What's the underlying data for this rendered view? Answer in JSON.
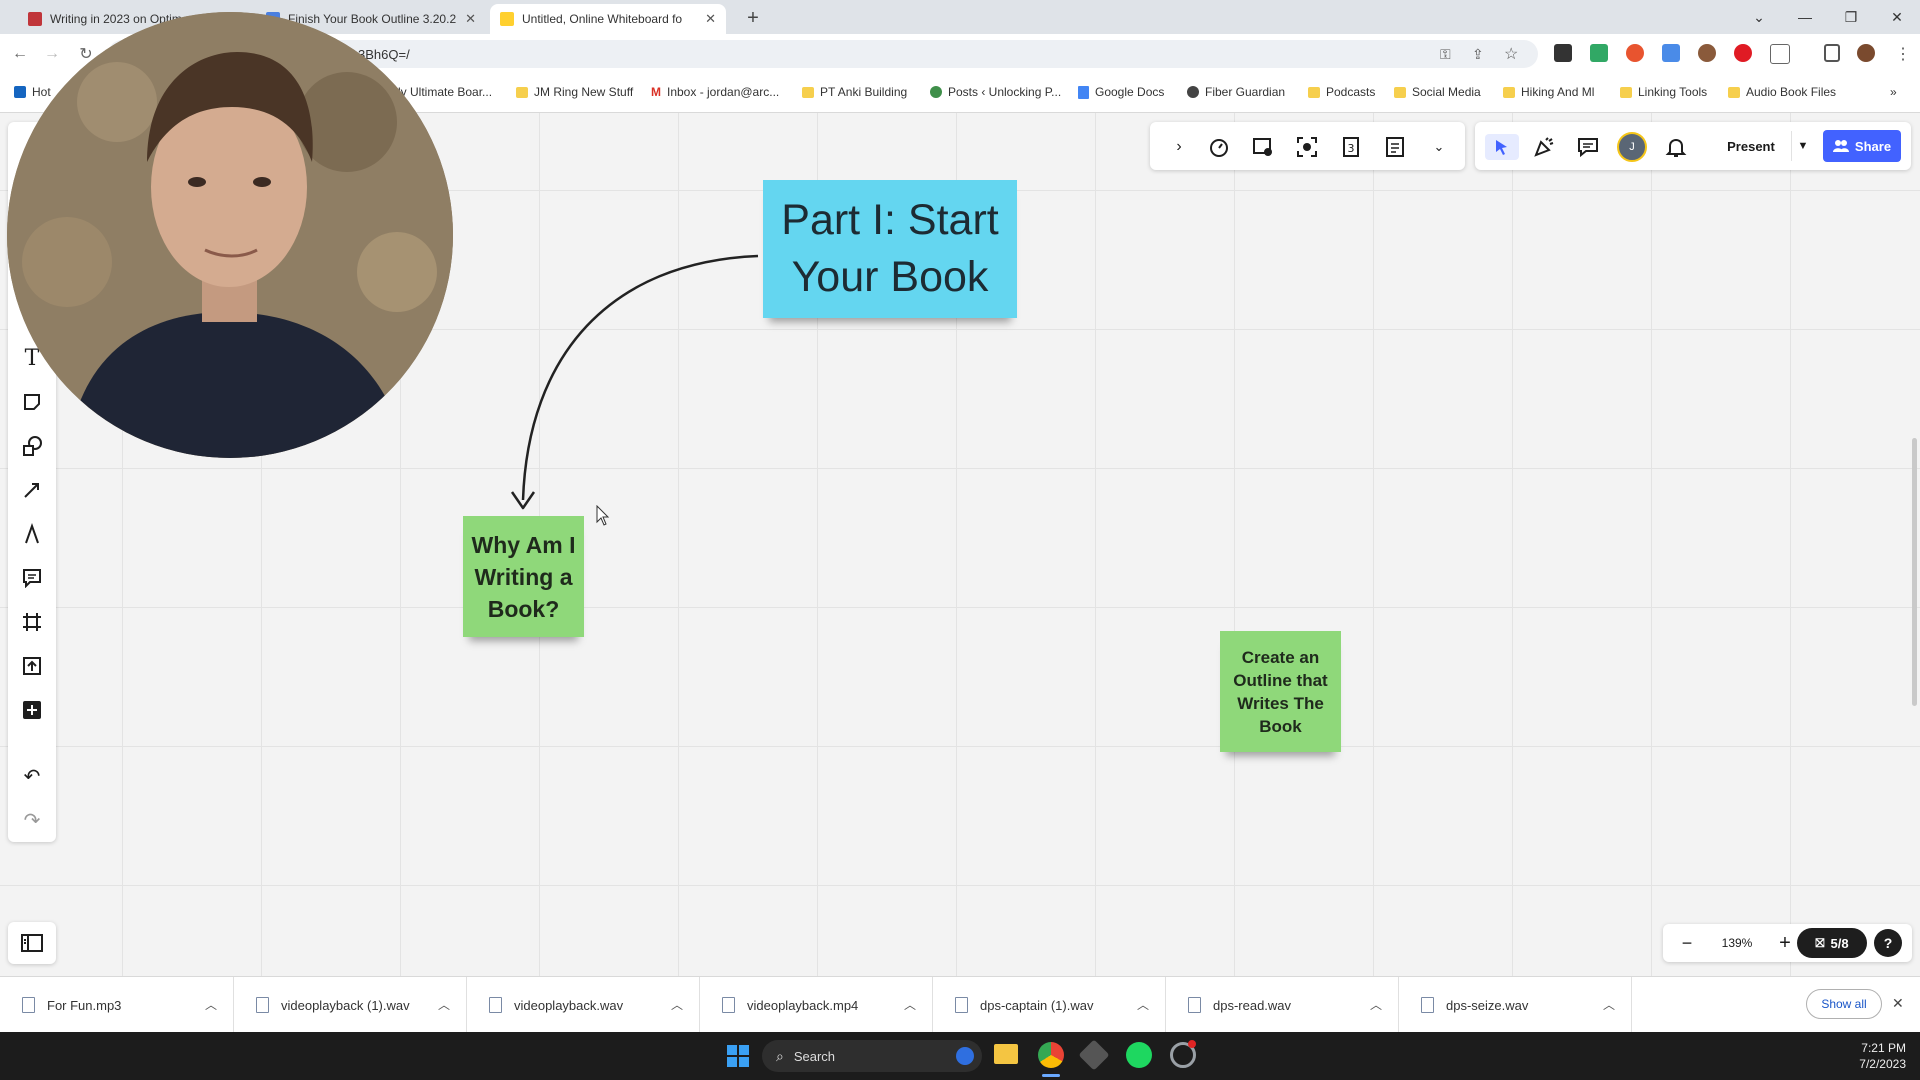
{
  "browser": {
    "tabs": [
      {
        "title": "Writing in 2023 on Optim",
        "active": false
      },
      {
        "title": "Finish Your Book Outline 3.20.2",
        "active": false
      },
      {
        "title": "Untitled, Online Whiteboard fo",
        "active": true
      }
    ],
    "url_fragment": "3Bh6Q=/",
    "bookmarks": [
      {
        "label": "Hot",
        "icon": "outlook-icon"
      },
      {
        "label": "ly Ultimate Boar...",
        "icon": "folder-icon"
      },
      {
        "label": "JM Ring New Stuff",
        "icon": "folder-icon"
      },
      {
        "label": "Inbox - jordan@arc...",
        "icon": "gmail-icon"
      },
      {
        "label": "PT Anki Building",
        "icon": "folder-icon"
      },
      {
        "label": "Posts ‹ Unlocking P...",
        "icon": "wordpress-icon"
      },
      {
        "label": "Google Docs",
        "icon": "docs-icon"
      },
      {
        "label": "Fiber Guardian",
        "icon": "globe-icon"
      },
      {
        "label": "Podcasts",
        "icon": "folder-icon"
      },
      {
        "label": "Social Media",
        "icon": "folder-icon"
      },
      {
        "label": "Hiking And Ml",
        "icon": "folder-icon"
      },
      {
        "label": "Linking Tools",
        "icon": "folder-icon"
      },
      {
        "label": "Audio Book Files",
        "icon": "folder-icon"
      }
    ]
  },
  "board": {
    "stickies": [
      {
        "text": "Part I: Start Your Book",
        "color": "#64d6f0"
      },
      {
        "text": "Why Am I Writing a Book?",
        "color": "#8fd87a"
      },
      {
        "text": "Create an Outline that Writes The Book",
        "color": "#8fd87a"
      }
    ],
    "toolbar": {
      "present_label": "Present",
      "share_label": "Share",
      "avatar_initial": "J"
    },
    "zoom": {
      "level": "139%",
      "minus": "−",
      "plus": "+",
      "frames": "5/8",
      "help": "?"
    }
  },
  "downloads": {
    "items": [
      "For Fun.mp3",
      "videoplayback (1).wav",
      "videoplayback.wav",
      "videoplayback.mp4",
      "dps-captain (1).wav",
      "dps-read.wav",
      "dps-seize.wav"
    ],
    "show_all_label": "Show all"
  },
  "taskbar": {
    "search_label": "Search",
    "time": "7:21 PM",
    "date": "7/2/2023"
  },
  "colors": {
    "accent": "#4262ff",
    "sticky_blue": "#64d6f0",
    "sticky_green": "#8fd87a"
  }
}
